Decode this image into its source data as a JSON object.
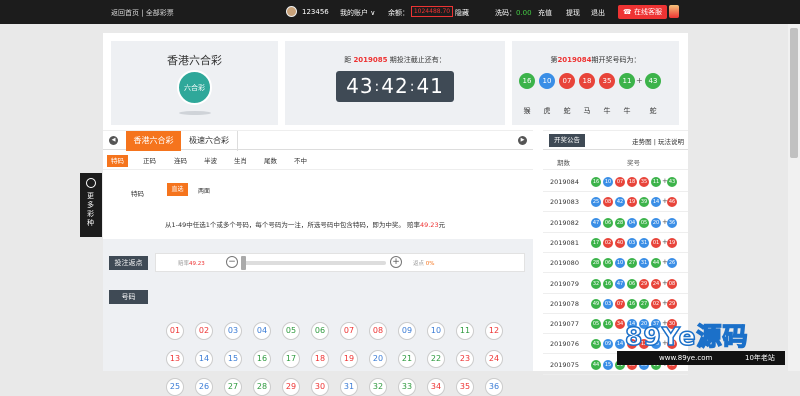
{
  "topbar": {
    "nav_left": "返回首页 | 全部彩票",
    "username": "123456",
    "my_account": "我的账户 ∨",
    "balance_label": "余额：",
    "balance": "1024488.70",
    "hide_label": "隐藏",
    "wash_label": "洗码：",
    "wash_value": "0.00",
    "recharge": "充值",
    "withdraw": "提现",
    "logout": "退出",
    "customer_service": "在线客服"
  },
  "lottery": {
    "name": "香港六合彩",
    "logo_text": "六合彩"
  },
  "countdown": {
    "prefix": "距",
    "period": "2019085",
    "suffix": "期投注截止还有：",
    "hh": "43",
    "mm": "42",
    "ss": "41"
  },
  "last_draw": {
    "prefix": "第",
    "period": "2019084",
    "suffix": "期开奖号码为：",
    "balls": [
      "16",
      "10",
      "07",
      "18",
      "35",
      "11",
      "43"
    ],
    "zodiacs": [
      "猴",
      "虎",
      "蛇",
      "马",
      "牛",
      "牛",
      "蛇"
    ],
    "colors": {
      "green": "#3cb34a",
      "blue": "#3a8ee6",
      "red": "#e8443a"
    }
  },
  "tabs": [
    "香港六合彩",
    "极速六合彩"
  ],
  "subtabs": [
    "特码",
    "正码",
    "连码",
    "半波",
    "生肖",
    "尾数",
    "不中"
  ],
  "play": {
    "label": "特码",
    "opt_on": "直选",
    "opt_off": "两面",
    "desc_prefix": "从1-49中任选1个或多个号码，每个号码为一注，所选号码中包含特码，即为中奖。 赔率",
    "desc_odds": "49.23",
    "desc_suffix": "元"
  },
  "bet": {
    "rebate_title": "投注返点",
    "odds_label": "赔率",
    "odds_value": "49.23",
    "rebate_label": "返点",
    "rebate_value": "0%",
    "numbers_title": "号码",
    "numbers": [
      "01",
      "02",
      "03",
      "04",
      "05",
      "06",
      "07",
      "08",
      "09",
      "10",
      "11",
      "12",
      "13",
      "14",
      "15",
      "16",
      "17",
      "18",
      "19",
      "20",
      "21",
      "22",
      "23",
      "24",
      "25",
      "26",
      "27",
      "28",
      "29",
      "30",
      "31",
      "32",
      "33",
      "34",
      "35",
      "36"
    ]
  },
  "sidebar_menu": "更多彩种",
  "history": {
    "tab": "开奖公告",
    "links": "走势图 | 玩法说明",
    "col_period": "期数",
    "col_numbers": "奖号",
    "rows": [
      {
        "period": "2019084",
        "balls": [
          "16",
          "10",
          "07",
          "18",
          "35",
          "11",
          "43"
        ]
      },
      {
        "period": "2019083",
        "balls": [
          "25",
          "08",
          "42",
          "19",
          "39",
          "14",
          "46"
        ]
      },
      {
        "period": "2019082",
        "balls": [
          "47",
          "06",
          "28",
          "04",
          "05",
          "20",
          "36"
        ]
      },
      {
        "period": "2019081",
        "balls": [
          "17",
          "02",
          "40",
          "03",
          "31",
          "01",
          "19"
        ]
      },
      {
        "period": "2019080",
        "balls": [
          "28",
          "06",
          "10",
          "27",
          "31",
          "44",
          "26"
        ]
      },
      {
        "period": "2019079",
        "balls": [
          "32",
          "16",
          "47",
          "06",
          "29",
          "24",
          "08"
        ]
      },
      {
        "period": "2019078",
        "balls": [
          "49",
          "03",
          "07",
          "16",
          "27",
          "02",
          "29"
        ]
      },
      {
        "period": "2019077",
        "balls": [
          "05",
          "16",
          "34",
          "14",
          "20",
          "37",
          "30"
        ]
      },
      {
        "period": "2019076",
        "balls": [
          "43",
          "09",
          "14",
          "01",
          "12",
          "25",
          "40"
        ]
      },
      {
        "period": "2019075",
        "balls": [
          "44",
          "15",
          "21",
          "08",
          "03",
          "11",
          "02"
        ]
      }
    ]
  },
  "watermark": {
    "brand": "89Ye源码",
    "url": "www.89ye.com",
    "tag": "10年老站"
  }
}
